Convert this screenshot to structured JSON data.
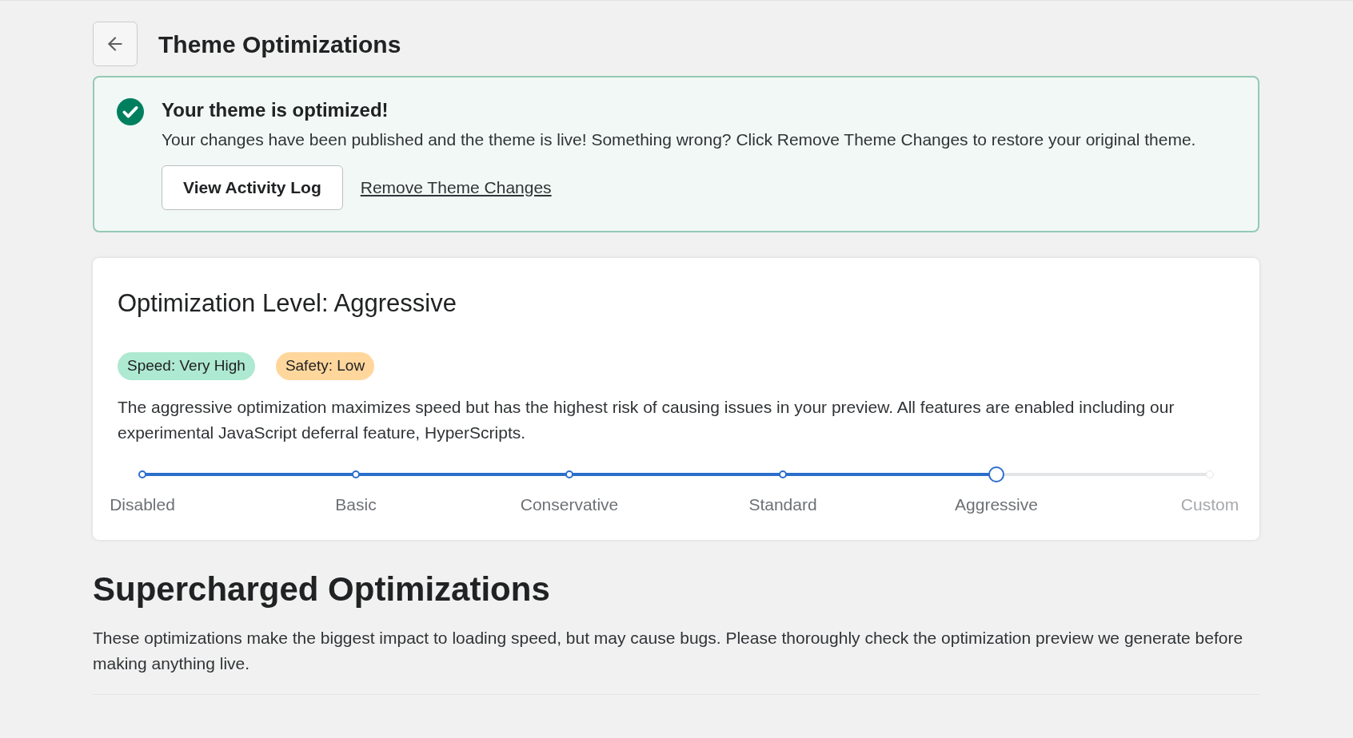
{
  "header": {
    "title": "Theme Optimizations"
  },
  "banner": {
    "title": "Your theme is optimized!",
    "message": "Your changes have been published and the theme is live! Something wrong? Click Remove Theme Changes to restore your original theme.",
    "button": "View Activity Log",
    "link": "Remove Theme Changes"
  },
  "level_card": {
    "title": "Optimization Level: Aggressive",
    "badges": [
      {
        "label": "Speed: Very High",
        "color": "#aee9d1"
      },
      {
        "label": "Safety: Low",
        "color": "#ffd79d"
      }
    ],
    "description": "The aggressive optimization maximizes speed but has the highest risk of causing issues in your preview. All features are enabled including our experimental JavaScript deferral feature, HyperScripts.",
    "slider": {
      "level": 0.8,
      "steps": [
        {
          "label": "Disabled",
          "selected": false,
          "disabled": false
        },
        {
          "label": "Basic",
          "selected": false,
          "disabled": false
        },
        {
          "label": "Conservative",
          "selected": false,
          "disabled": false
        },
        {
          "label": "Standard",
          "selected": false,
          "disabled": false
        },
        {
          "label": "Aggressive",
          "selected": true,
          "disabled": false
        },
        {
          "label": "Custom",
          "selected": false,
          "disabled": true
        }
      ]
    }
  },
  "section": {
    "title": "Supercharged Optimizations",
    "description": "These optimizations make the biggest impact to loading speed, but may cause bugs. Please thoroughly check the optimization preview we generate before making anything live."
  }
}
